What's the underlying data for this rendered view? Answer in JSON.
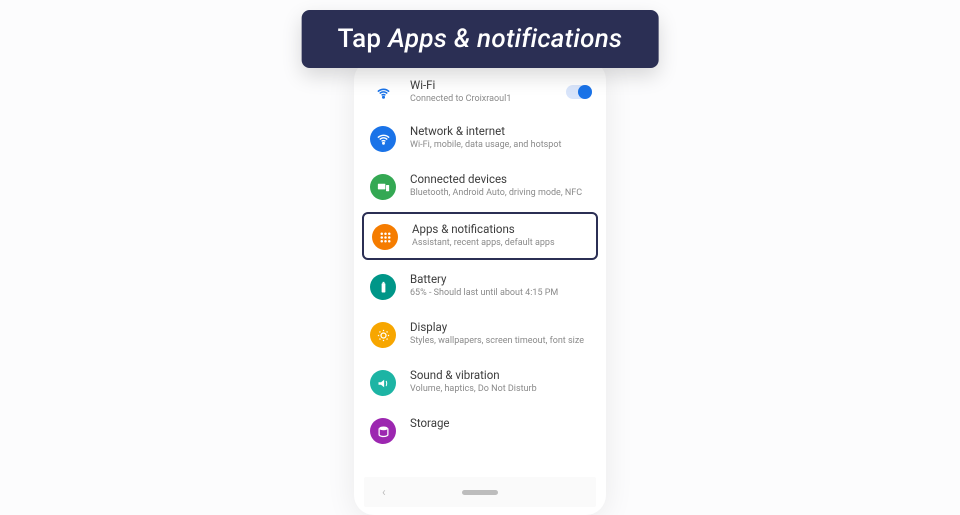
{
  "banner": {
    "prefix": "Tap ",
    "target": "Apps & notifications"
  },
  "settings": {
    "wifi": {
      "title": "Wi-Fi",
      "sub": "Connected to Croixraoul1"
    },
    "network": {
      "title": "Network & internet",
      "sub": "Wi-Fi, mobile, data usage, and hotspot"
    },
    "connected": {
      "title": "Connected devices",
      "sub": "Bluetooth, Android Auto, driving mode, NFC"
    },
    "apps": {
      "title": "Apps & notifications",
      "sub": "Assistant, recent apps, default apps"
    },
    "battery": {
      "title": "Battery",
      "sub": "65% - Should last until about 4:15 PM"
    },
    "display": {
      "title": "Display",
      "sub": "Styles, wallpapers, screen timeout, font size"
    },
    "sound": {
      "title": "Sound & vibration",
      "sub": "Volume, haptics, Do Not Disturb"
    },
    "storage": {
      "title": "Storage",
      "sub": ""
    }
  }
}
